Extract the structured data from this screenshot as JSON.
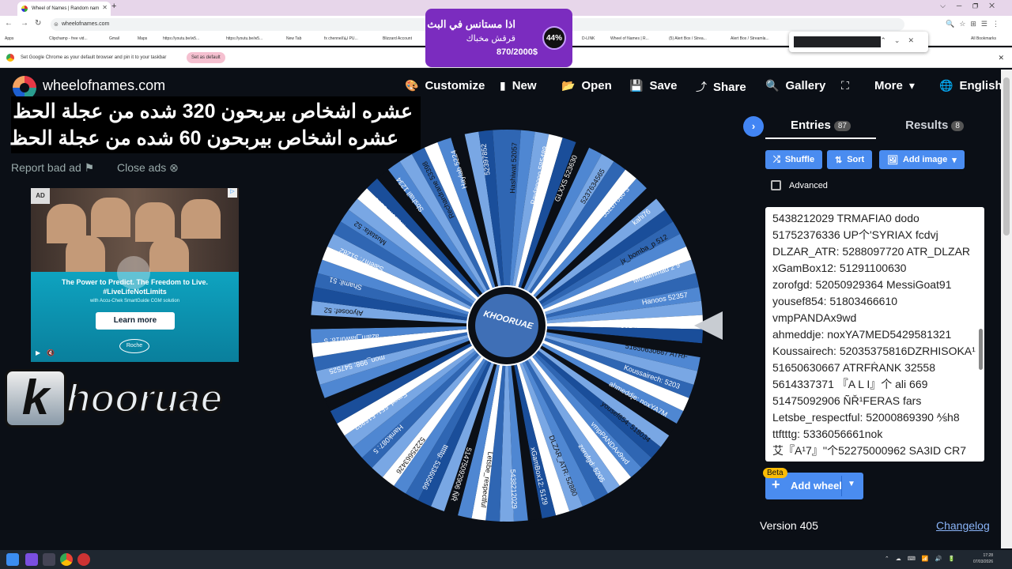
{
  "browser": {
    "tab_title": "Wheel of Names | Random nam",
    "url": "wheelofnames.com",
    "bookmarks": [
      "Apps",
      "Clipchamp - free vid...",
      "Gmail",
      "Maps",
      "https://youtu.be/w5...",
      "https://youtu.be/w5...",
      "New Tab",
      "fx chennel/ليلا PU...",
      "Blizzard Account",
      "D-LINK",
      "Wheel of Names | R...",
      "(5) Alert Box / Strea...",
      "Alert Box / Streamla...",
      "All Bookmarks"
    ],
    "infobar_text": "Set Google Chrome as your default browser and pin it to your taskbar",
    "infobar_button": "Set as default"
  },
  "donation": {
    "line1": "اذا مستانس في البث",
    "line2": "قرقش مخباك",
    "amount": "870/2000$",
    "percent": "44%"
  },
  "header": {
    "brand": "wheelofnames.com",
    "nav": [
      {
        "label": "Customize",
        "icon": "palette-icon"
      },
      {
        "label": "New",
        "icon": "file-icon"
      },
      {
        "label": "Open",
        "icon": "folder-icon"
      },
      {
        "label": "Save",
        "icon": "save-icon"
      },
      {
        "label": "Share",
        "icon": "share-icon"
      },
      {
        "label": "Gallery",
        "icon": "search-icon"
      },
      {
        "label": "",
        "icon": "fullscreen-icon"
      },
      {
        "label": "More",
        "icon": "chevron-down-icon"
      },
      {
        "label": "English",
        "icon": "globe-icon"
      }
    ]
  },
  "overlay": {
    "line1": "عشره اشخاص بيربحون 320 شده من عجلة الحظ",
    "line2": "عشره اشخاص بيربحون 60 شده من عجلة الحظ"
  },
  "ads": {
    "report": "Report bad ad",
    "close": "Close ads",
    "badge": "AD",
    "headline": "The Power to Predict. The Freedom to Live. #LiveLifeNotLimits",
    "sub": "with Accu-Chek SmartGuide CGM solution",
    "cta": "Learn more",
    "brand": "Roche"
  },
  "channel_logo": {
    "k": "k",
    "text": "hooruae"
  },
  "wheel": {
    "center_text": "KHOORUAE",
    "segment_colors": [
      "#0b0f16",
      "#2f66b3",
      "#4f87d2",
      "#79a7e4",
      "#ffffff",
      "#1a4e9a"
    ],
    "visible_labels": [
      "5614337371 『A L I』",
      "51650630667 ATRF",
      "Koussairech: 5203",
      "ahmeddje: noxYA7M",
      "yousef854: 518034",
      "vmpPANDAx9wd",
      "zorofgd: 5205",
      "DLZAR_ATR: 52880",
      "xGamBox12: 5129",
      "5438212029",
      "Letsbe_respectful",
      "51475092906 ÑŘ",
      "tttttg: 53360566",
      "52225663426",
      "Hamk087: 5",
      "Emod_651: 516893",
      "mohammed696: 51",
      "mon_998: 547525",
      "azam_jiawuf18: 5",
      "Alyoosef: 52",
      "Shamil: 51",
      "Salem7: 51282",
      "Mustafa: 52",
      "Mazen: 5179",
      "Sbshail 1234",
      "Rechardrane 53398",
      "Haylab 5224",
      "52397852",
      "Hashiwat 52057",
      "Paylanooo 585489",
      "GLXXS 523630",
      "5237634565",
      "53287680 3",
      "kahi76",
      "jx_bomba_p 512",
      "Mohammad 2 9",
      "Hanoos 52357"
    ]
  },
  "panel": {
    "tabs": [
      {
        "label": "Entries",
        "count": "87"
      },
      {
        "label": "Results",
        "count": "8"
      }
    ],
    "buttons": [
      {
        "label": "Shuffle",
        "icon": "shuffle-icon"
      },
      {
        "label": "Sort",
        "icon": "sort-icon"
      },
      {
        "label": "Add image",
        "icon": "image-icon"
      }
    ],
    "advanced_label": "Advanced",
    "entries": [
      "5438212029 TRMAFIA0 dodo",
      "51752376336 UP个'SYRIAX fcdvj",
      "DLZAR_ATR: 5288097720 ATR_DLZAR",
      "xGamBox12: 51291100630",
      "zorofgd: 52050929364 MessiGoat91",
      "yousef854: 51803466610",
      "vmpPANDAx9wd",
      "ahmeddje: noxYA7MED5429581321",
      "Koussairech: 52035375816DZRHISOKA¹",
      "51650630667 ATRFṘANK 32558",
      "5614337371 『A L I』个 ali 669",
      "51475092906 ÑŘ¹FERAS fars",
      "Letsbe_respectful: 52000869390 ⅍h8",
      "ttftttg: 5336056661nok",
      "艾『A¹7』''个52275000962 SA3ID CR7"
    ],
    "beta": "Beta",
    "add_wheel": "Add wheel",
    "version": "Version 405",
    "changelog": "Changelog"
  },
  "taskbar": {
    "time": "17:28",
    "date": "07/03/2026"
  }
}
